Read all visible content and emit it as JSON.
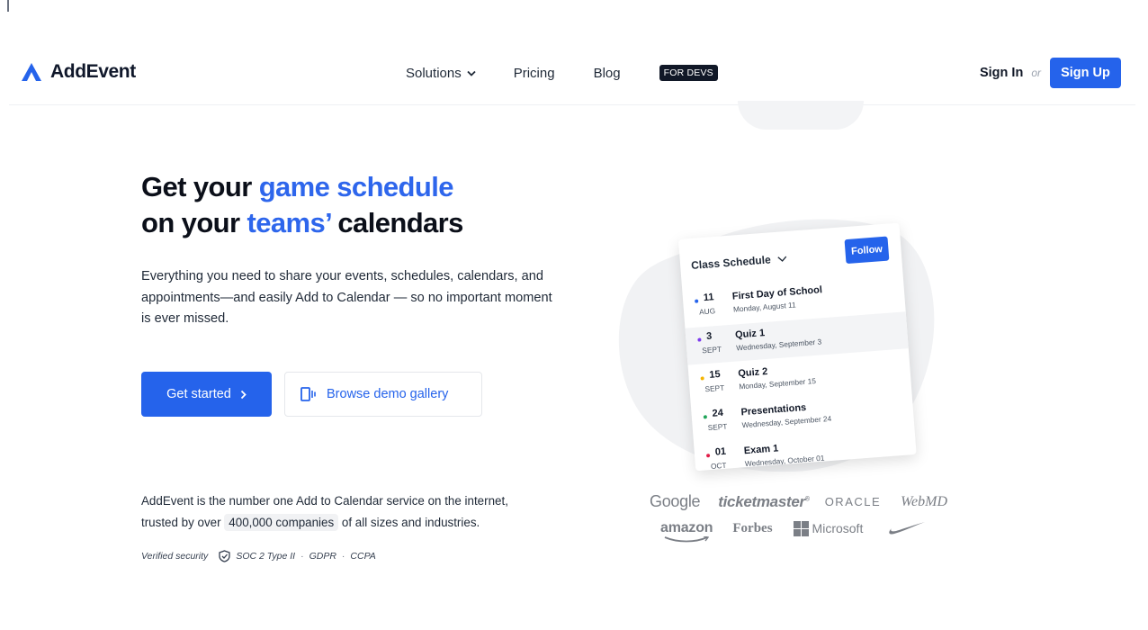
{
  "header": {
    "brand": "AddEvent",
    "nav": {
      "solutions": "Solutions",
      "pricing": "Pricing",
      "blog": "Blog",
      "devs_badge": "FOR DEVS"
    },
    "sign_in": "Sign In",
    "or": "or",
    "sign_up": "Sign Up"
  },
  "hero": {
    "title_line1_a": "Get your ",
    "title_line1_b": "game schedule",
    "title_line2_a": "on your ",
    "title_line2_b": "teams’",
    "title_line2_c": " calendars",
    "lead": "Everything you need to share your events, schedules, calendars, and appointments—and easily Add to Calendar — so no important moment is ever missed.",
    "cta_primary": "Get started",
    "cta_secondary": "Browse demo gallery",
    "stat_a": "AddEvent is the number one Add to Calendar service on the internet, trusted by over ",
    "stat_pill": "400,000 companies",
    "stat_b": " of all sizes and industries.",
    "security_label": "Verified security",
    "security_items": [
      "SOC 2 Type II",
      "GDPR",
      "CCPA"
    ],
    "security_sep": "·"
  },
  "calendar_card": {
    "title": "Class Schedule",
    "follow": "Follow",
    "events": [
      {
        "day": "11",
        "month": "AUG",
        "name": "First Day of School",
        "sub": "Monday, August 11",
        "color": "#2563eb",
        "highlight": false
      },
      {
        "day": "3",
        "month": "SEPT",
        "name": "Quiz 1",
        "sub": "Wednesday, September 3",
        "color": "#7c3aed",
        "highlight": true
      },
      {
        "day": "15",
        "month": "SEPT",
        "name": "Quiz 2",
        "sub": "Monday, September 15",
        "color": "#f5b400",
        "highlight": false
      },
      {
        "day": "24",
        "month": "SEPT",
        "name": "Presentations",
        "sub": "Wednesday, September 24",
        "color": "#22a55a",
        "highlight": false
      },
      {
        "day": "01",
        "month": "OCT",
        "name": "Exam 1",
        "sub": "Wednesday, October 01",
        "color": "#e11d48",
        "highlight": false
      }
    ]
  },
  "logos": {
    "google": "Google",
    "ticketmaster": "ticketmaster",
    "ticketmaster_mark": "®",
    "oracle": "ORACLE",
    "webmd": "WebMD",
    "amazon": "amazon",
    "forbes": "Forbes",
    "microsoft": "Microsoft",
    "nike": "nike-swoosh"
  },
  "colors": {
    "accent": "#2563eb",
    "heading": "#0b0f19",
    "logo_gray": "#7b7f86"
  }
}
